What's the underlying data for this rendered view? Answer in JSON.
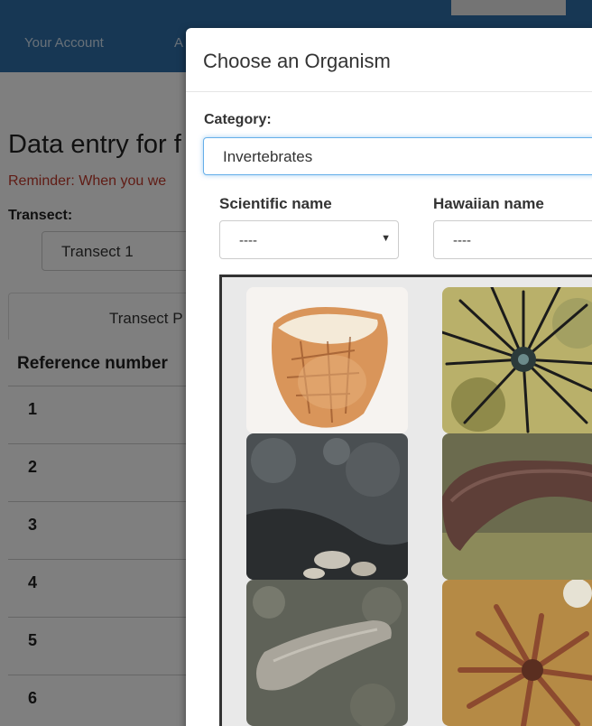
{
  "navbar": {
    "your_account": "Your Account",
    "second_link": "A"
  },
  "background": {
    "page_title": "Data entry for f",
    "reminder": "Reminder: When you we",
    "transect_label": "Transect:",
    "transect_value": "Transect 1",
    "tab_label": "Transect P",
    "ref_header": "Reference number",
    "rows": [
      "1",
      "2",
      "3",
      "4",
      "5",
      "6"
    ]
  },
  "modal": {
    "title": "Choose an Organism",
    "category_label": "Category:",
    "category_value": "Invertebrates",
    "scientific_label": "Scientific name",
    "scientific_value": "----",
    "hawaiian_label": "Hawaiian name",
    "hawaiian_value": "----"
  },
  "gallery": {
    "photos": [
      {
        "subject": "cone-shell"
      },
      {
        "subject": "sea-urchin"
      },
      {
        "subject": "dark-sea-cucumber-on-rock"
      },
      {
        "subject": "brown-sea-cucumber"
      },
      {
        "subject": "grey-sea-cucumber"
      },
      {
        "subject": "slate-pencil-urchin"
      }
    ]
  },
  "colors": {
    "navbar": "#2f6fa8",
    "reminder": "#c0392b",
    "focus_border": "#66afe9"
  }
}
